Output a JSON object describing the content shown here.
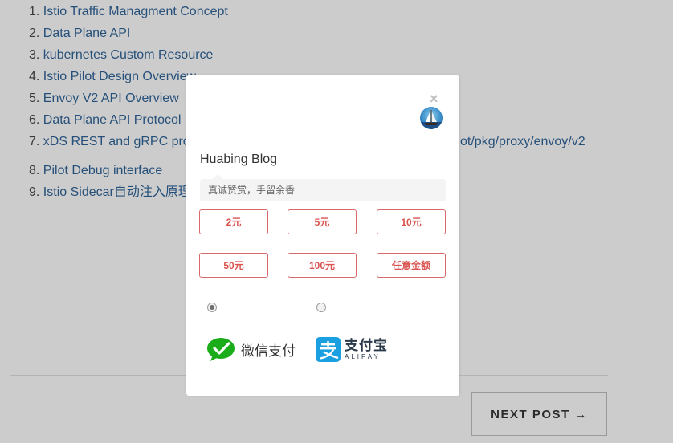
{
  "references": {
    "items": [
      {
        "num": "1.",
        "text": "Istio Traffic Managment Concept",
        "tail": ""
      },
      {
        "num": "2.",
        "text": "Data Plane API",
        "tail": ""
      },
      {
        "num": "3.",
        "text": "kubernetes Custom Resource",
        "tail": ""
      },
      {
        "num": "4.",
        "text": "Istio Pilot Design Overview",
        "tail": ""
      },
      {
        "num": "5.",
        "text": "Envoy V2 API Overview",
        "tail": ""
      },
      {
        "num": "6.",
        "text": "Data Plane API Protocol",
        "tail": ""
      },
      {
        "num": "7.",
        "text": "xDS REST and gRPC pro",
        "tail": "ot/pkg/proxy/envoy/v2"
      },
      {
        "num": "8.",
        "text": "Pilot Debug interface",
        "tail": ""
      },
      {
        "num": "9.",
        "text": "Istio Sidecar自动注入原理",
        "tail": ""
      }
    ]
  },
  "navigation": {
    "next_post_label": "NEXT POST →"
  },
  "donate_modal": {
    "close_label": "×",
    "blog_name": "Huabing Blog",
    "message_placeholder": "真诚赞赏，手留余香",
    "amounts": [
      "2元",
      "5元",
      "10元",
      "50元",
      "100元",
      "任意金额"
    ],
    "payment_methods": [
      {
        "id": "wechat",
        "label": "微信支付",
        "selected": true,
        "icon": "wechat-pay-icon"
      },
      {
        "id": "alipay",
        "label": "支付宝",
        "sub_label": "ALIPAY",
        "selected": false,
        "icon": "alipay-icon"
      }
    ]
  },
  "colors": {
    "overlay_bg": "#cccccc",
    "link": "#26507a",
    "amount_accent": "#d9534f",
    "wechat_green": "#1aad19",
    "alipay_blue": "#1a9fe0"
  }
}
